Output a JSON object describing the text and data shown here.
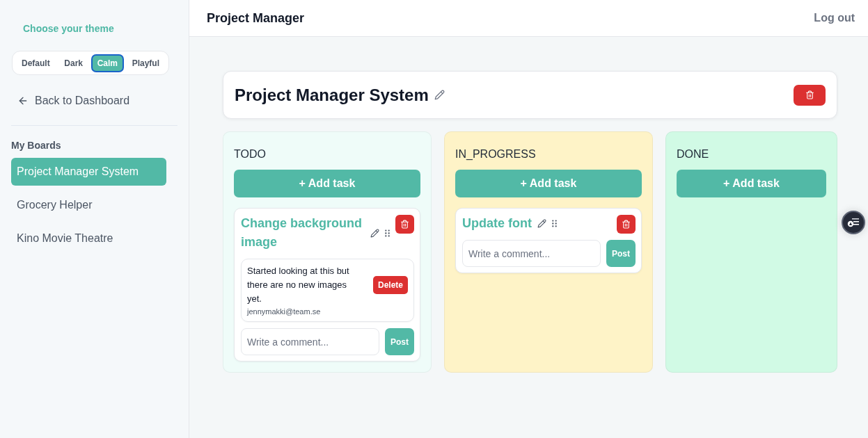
{
  "sidebar": {
    "theme_title": "Choose your theme",
    "themes": [
      {
        "label": "Default",
        "selected": false
      },
      {
        "label": "Dark",
        "selected": false
      },
      {
        "label": "Calm",
        "selected": true
      },
      {
        "label": "Playful",
        "selected": false
      }
    ],
    "back_link": "Back to Dashboard",
    "boards_title": "My Boards",
    "boards": [
      {
        "label": "Project Manager System",
        "selected": true
      },
      {
        "label": "Grocery Helper",
        "selected": false
      },
      {
        "label": "Kino Movie Theatre",
        "selected": false
      }
    ]
  },
  "header": {
    "title": "Project Manager",
    "logout": "Log out"
  },
  "board": {
    "title": "Project Manager System",
    "columns": [
      {
        "title": "TODO",
        "color": "#effcf9",
        "add_label": "+ Add task",
        "tasks": [
          {
            "title": "Change background image",
            "comments": [
              {
                "text": "Started looking at this but there are no new images yet.",
                "author": "jennymakki@team.se",
                "delete_label": "Delete"
              }
            ],
            "comment_placeholder": "Write a comment...",
            "post_label": "Post"
          }
        ]
      },
      {
        "title": "IN_PROGRESS",
        "color": "#fef3c7",
        "add_label": "+ Add task",
        "tasks": [
          {
            "title": "Update font",
            "comment_placeholder": "Write a comment...",
            "post_label": "Post"
          }
        ]
      },
      {
        "title": "DONE",
        "color": "#d1fae5",
        "add_label": "+ Add task"
      }
    ]
  }
}
